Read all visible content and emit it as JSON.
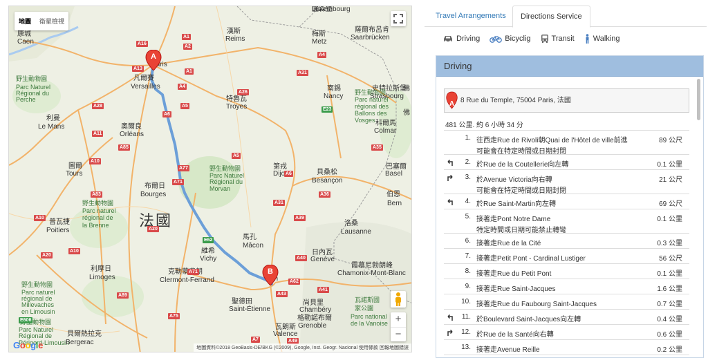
{
  "map": {
    "map_type_buttons": [
      "地圖",
      "衛星檢視"
    ],
    "labels": [
      {
        "text": "康城",
        "cls": "city"
      },
      {
        "text": "Caen",
        "cls": "cityEn"
      },
      {
        "text": "野生動物園",
        "cls": "green"
      },
      {
        "text": "Parc Naturel",
        "cls": "green"
      },
      {
        "text": "Régional du",
        "cls": "green"
      },
      {
        "text": "Perche",
        "cls": "green"
      },
      {
        "text": "利曼",
        "cls": "city"
      },
      {
        "text": "Le Mans",
        "cls": "cityEn"
      },
      {
        "text": "奧爾良",
        "cls": "city"
      },
      {
        "text": "Orléans",
        "cls": "cityEn"
      },
      {
        "text": "圖爾",
        "cls": "city"
      },
      {
        "text": "Tours",
        "cls": "cityEn"
      },
      {
        "text": "布爾日",
        "cls": "city"
      },
      {
        "text": "Bourges",
        "cls": "cityEn"
      },
      {
        "text": "普瓦捷",
        "cls": "city"
      },
      {
        "text": "Poitiers",
        "cls": "cityEn"
      },
      {
        "text": "野生動物園",
        "cls": "green"
      },
      {
        "text": "Parc naturel",
        "cls": "green"
      },
      {
        "text": "régional de",
        "cls": "green"
      },
      {
        "text": "la Brenne",
        "cls": "green"
      },
      {
        "text": "利摩日",
        "cls": "city"
      },
      {
        "text": "Limoges",
        "cls": "cityEn"
      },
      {
        "text": "野生動物園",
        "cls": "green"
      },
      {
        "text": "Parc naturel",
        "cls": "green"
      },
      {
        "text": "régional de",
        "cls": "green"
      },
      {
        "text": "Millevaches",
        "cls": "green"
      },
      {
        "text": "en Limousin",
        "cls": "green"
      },
      {
        "text": "野生動物園",
        "cls": "green"
      },
      {
        "text": "Parc Naturel",
        "cls": "green"
      },
      {
        "text": "Régional de",
        "cls": "green"
      },
      {
        "text": "Périgord-Limousin",
        "cls": "green"
      },
      {
        "text": "貝爾熱拉克",
        "cls": "city"
      },
      {
        "text": "Bergerac",
        "cls": "cityEn"
      },
      {
        "text": "凡爾賽",
        "cls": "city"
      },
      {
        "text": "Versailles",
        "cls": "cityEn"
      },
      {
        "text": "Paris",
        "cls": "cityEn"
      },
      {
        "text": "漢斯",
        "cls": "city"
      },
      {
        "text": "Reims",
        "cls": "cityEn"
      },
      {
        "text": "特魯瓦",
        "cls": "city"
      },
      {
        "text": "Troyes",
        "cls": "cityEn"
      },
      {
        "text": "梅斯",
        "cls": "city"
      },
      {
        "text": "Metz",
        "cls": "cityEn"
      },
      {
        "text": "南錫",
        "cls": "city"
      },
      {
        "text": "Nancy",
        "cls": "cityEn"
      },
      {
        "text": "史特拉斯堡",
        "cls": "city"
      },
      {
        "text": "Strasbourg",
        "cls": "cityEn"
      },
      {
        "text": "科爾馬",
        "cls": "city"
      },
      {
        "text": "Colmar",
        "cls": "cityEn"
      },
      {
        "text": "盧森堡",
        "cls": "city"
      },
      {
        "text": "Luxembourg",
        "cls": "cityEn"
      },
      {
        "text": "薩爾布呂肯",
        "cls": "city"
      },
      {
        "text": "Saarbrücken",
        "cls": "cityEn"
      },
      {
        "text": "第戎",
        "cls": "city"
      },
      {
        "text": "Dijon",
        "cls": "cityEn"
      },
      {
        "text": "貝桑松",
        "cls": "city"
      },
      {
        "text": "Besançon",
        "cls": "cityEn"
      },
      {
        "text": "巴塞爾",
        "cls": "city"
      },
      {
        "text": "Basel",
        "cls": "cityEn"
      },
      {
        "text": "伯恩",
        "cls": "city"
      },
      {
        "text": "Bern",
        "cls": "cityEn"
      },
      {
        "text": "洛桑",
        "cls": "city"
      },
      {
        "text": "Lausanne",
        "cls": "cityEn"
      },
      {
        "text": "日內瓦",
        "cls": "city"
      },
      {
        "text": "Genève",
        "cls": "cityEn"
      },
      {
        "text": "霞慕尼勃朗峰",
        "cls": "city"
      },
      {
        "text": "Chamonix-Mont-Blanc",
        "cls": "cityEn"
      },
      {
        "text": "馬孔",
        "cls": "city"
      },
      {
        "text": "Mâcon",
        "cls": "cityEn"
      },
      {
        "text": "維希",
        "cls": "city"
      },
      {
        "text": "Vichy",
        "cls": "cityEn"
      },
      {
        "text": "克勒蒙費朗",
        "cls": "city"
      },
      {
        "text": "Clermont-Ferrand",
        "cls": "cityEn"
      },
      {
        "text": "聖德田",
        "cls": "city"
      },
      {
        "text": "Saint-Étienne",
        "cls": "cityEn"
      },
      {
        "text": "尚貝里",
        "cls": "city"
      },
      {
        "text": "Chambéry",
        "cls": "cityEn"
      },
      {
        "text": "格勒諾布爾",
        "cls": "city"
      },
      {
        "text": "Grenoble",
        "cls": "cityEn"
      },
      {
        "text": "瓦朗斯",
        "cls": "city"
      },
      {
        "text": "Valence",
        "cls": "cityEn"
      },
      {
        "text": "瓦諾斯國",
        "cls": "green"
      },
      {
        "text": "家公園",
        "cls": "green"
      },
      {
        "text": "Parc national",
        "cls": "green"
      },
      {
        "text": "de la Vanoise",
        "cls": "green"
      },
      {
        "text": "野生動物園",
        "cls": "green"
      },
      {
        "text": "Parc Naturel",
        "cls": "green"
      },
      {
        "text": "Régional du",
        "cls": "green"
      },
      {
        "text": "Morvan",
        "cls": "green"
      },
      {
        "text": "野生動物園",
        "cls": "green"
      },
      {
        "text": "Parc naturel",
        "cls": "green"
      },
      {
        "text": "régional des",
        "cls": "green"
      },
      {
        "text": "Ballons des",
        "cls": "green"
      },
      {
        "text": "Vosges",
        "cls": "green"
      },
      {
        "text": "佛",
        "cls": "city"
      },
      {
        "text": "佛",
        "cls": "city"
      },
      {
        "text": "法國",
        "cls": "big"
      },
      {
        "text": "on",
        "cls": "cityEn"
      }
    ],
    "shields": [
      {
        "text": "A16",
        "g": false
      },
      {
        "text": "A13",
        "g": false
      },
      {
        "text": "A1",
        "g": false
      },
      {
        "text": "A4",
        "g": false
      },
      {
        "text": "A31",
        "g": false
      },
      {
        "text": "A28",
        "g": false
      },
      {
        "text": "A11",
        "g": false
      },
      {
        "text": "A10",
        "g": false
      },
      {
        "text": "A85",
        "g": false
      },
      {
        "text": "A83",
        "g": false
      },
      {
        "text": "A71",
        "g": false
      },
      {
        "text": "A20",
        "g": false
      },
      {
        "text": "A89",
        "g": false
      },
      {
        "text": "A75",
        "g": false
      },
      {
        "text": "A26",
        "g": false
      },
      {
        "text": "A5",
        "g": false
      },
      {
        "text": "A6",
        "g": false
      },
      {
        "text": "A77",
        "g": false
      },
      {
        "text": "A31",
        "g": false
      },
      {
        "text": "A39",
        "g": false
      },
      {
        "text": "A36",
        "g": false
      },
      {
        "text": "A40",
        "g": false
      },
      {
        "text": "A43",
        "g": false
      },
      {
        "text": "A41",
        "g": false
      },
      {
        "text": "A49",
        "g": false
      },
      {
        "text": "A7",
        "g": false
      },
      {
        "text": "A10",
        "g": false
      },
      {
        "text": "A35",
        "g": false
      },
      {
        "text": "E23",
        "g": true
      },
      {
        "text": "E62",
        "g": true
      },
      {
        "text": "E606",
        "g": true
      },
      {
        "text": "A20",
        "g": false
      },
      {
        "text": "A1",
        "g": false
      },
      {
        "text": "A2",
        "g": false
      },
      {
        "text": "A4",
        "g": false
      },
      {
        "text": "A6",
        "g": false
      },
      {
        "text": "A71",
        "g": false
      },
      {
        "text": "A10",
        "g": false
      },
      {
        "text": "A5",
        "g": false
      },
      {
        "text": "A62",
        "g": false
      }
    ],
    "markers": [
      "A",
      "B"
    ],
    "logo": "Google",
    "attribution": "地圖資料©2018 GeoBasis-DE/BKG (©2009), Google, Inst. Geogr. Nacional   使用條款   回報地圖錯誤",
    "zoom_in": "+",
    "zoom_out": "−",
    "route_color": "#6c9fd8"
  },
  "tabs": [
    "Travel Arrangements",
    "Directions Service"
  ],
  "modes": [
    "Driving",
    "Bicyclig",
    "Transit",
    "Walking"
  ],
  "directions": {
    "header": "Driving",
    "start_marker": "A",
    "start_address": "8 Rue du Temple, 75004 Paris, 法國",
    "summary": "481 公里. 約 6 小時 34 分",
    "steps": [
      {
        "n": "1.",
        "turn": "",
        "text": "往西走Rue de Rivoli朝Quai de l'Hôtel de ville前進",
        "note": "可能會在特定時間或日期封閉",
        "dist": "89 公尺"
      },
      {
        "n": "2.",
        "turn": "left",
        "text": "於Rue de la Coutellerie向左轉",
        "note": "",
        "dist": "0.1 公里"
      },
      {
        "n": "3.",
        "turn": "right",
        "text": "於Avenue Victoria向右轉",
        "note": "可能會在特定時間或日期封閉",
        "dist": "21 公尺"
      },
      {
        "n": "4.",
        "turn": "left",
        "text": "於Rue Saint-Martin向左轉",
        "note": "",
        "dist": "69 公尺"
      },
      {
        "n": "5.",
        "turn": "",
        "text": "接著走Pont Notre Dame",
        "note": "特定時間或日期可能禁止轉彎",
        "dist": "0.1 公里"
      },
      {
        "n": "6.",
        "turn": "",
        "text": "接著走Rue de la Cité",
        "note": "",
        "dist": "0.3 公里"
      },
      {
        "n": "7.",
        "turn": "",
        "text": "接著走Petit Pont - Cardinal Lustiger",
        "note": "",
        "dist": "56 公尺"
      },
      {
        "n": "8.",
        "turn": "",
        "text": "接著走Rue du Petit Pont",
        "note": "",
        "dist": "0.1 公里"
      },
      {
        "n": "9.",
        "turn": "",
        "text": "接著走Rue Saint-Jacques",
        "note": "",
        "dist": "1.6 公里"
      },
      {
        "n": "10.",
        "turn": "",
        "text": "接著走Rue du Faubourg Saint-Jacques",
        "note": "",
        "dist": "0.7 公里"
      },
      {
        "n": "11.",
        "turn": "left",
        "text": "於Boulevard Saint-Jacques向左轉",
        "note": "",
        "dist": "0.4 公里"
      },
      {
        "n": "12.",
        "turn": "right",
        "text": "於Rue de la Santé向右轉",
        "note": "",
        "dist": "0.6 公里"
      },
      {
        "n": "13.",
        "turn": "",
        "text": "接著走Avenue Reille",
        "note": "",
        "dist": "0.2 公里"
      }
    ]
  }
}
